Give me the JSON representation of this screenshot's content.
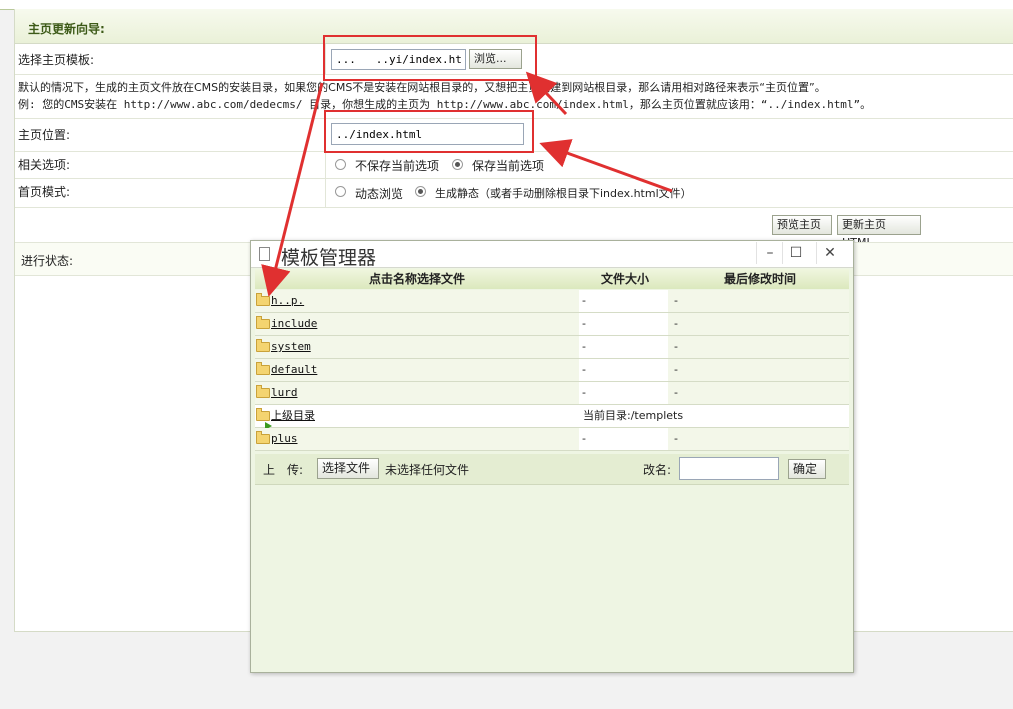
{
  "panel": {
    "title": "主页更新向导:",
    "template_label": "选择主页模板:",
    "template_value": "...   ..yi/index.htm",
    "browse_button": "浏览...",
    "desc_line1": "默认的情况下，生成的主页文件放在CMS的安装目录，如果您的CMS不是安装在网站根目录的，又想把主页创建到网站根目录，那么请用相对路径来表示“主页位置”。",
    "desc_line2": "例: 您的CMS安装在 http://www.abc.com/dedecms/ 目录，你想生成的主页为 http://www.abc.com/index.html，那么主页位置就应该用：“../index.html”。",
    "position_label": "主页位置:",
    "position_value": "../index.html",
    "options_label": "相关选项:",
    "option_no_save": "不保存当前选项",
    "option_save": "保存当前选项",
    "mode_label": "首页模式:",
    "mode_dynamic": "动态浏览",
    "mode_static": "生成静态（或者手动删除根目录下index.html文件）",
    "preview_button": "预览主页",
    "update_button": "更新主页HTML",
    "status_label": "进行状态:"
  },
  "modal": {
    "title": "模板管理器",
    "minimize": "–",
    "maximize": "☐",
    "close": "✕",
    "columns": [
      "点击名称选择文件",
      "文件大小",
      "最后修改时间"
    ],
    "rows": [
      {
        "name": "h..p.",
        "size": "-",
        "time": "-"
      },
      {
        "name": "include",
        "size": "-",
        "time": "-"
      },
      {
        "name": "system",
        "size": "-",
        "time": "-"
      },
      {
        "name": "default",
        "size": "-",
        "time": "-"
      },
      {
        "name": "lurd",
        "size": "-",
        "time": "-"
      },
      {
        "name": "上级目录",
        "info": "当前目录:/templets"
      },
      {
        "name": "plus",
        "size": "-",
        "time": "-"
      }
    ],
    "upload_label": "上　传:",
    "choose_file": "选择文件",
    "no_file": "未选择任何文件",
    "rename_label": "改名:",
    "rename_value": "",
    "confirm": "确定"
  },
  "colors": {
    "annotation": "#e03030",
    "header_text": "#3d5a18",
    "modal_bg": "#eef5e3"
  }
}
